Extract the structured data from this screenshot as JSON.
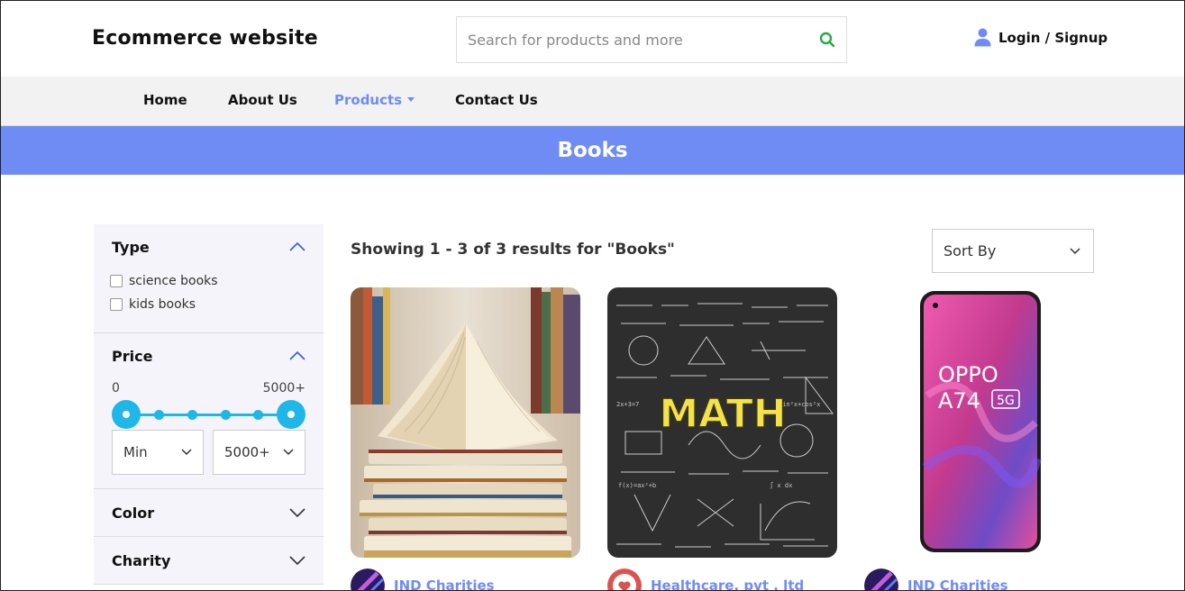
{
  "header": {
    "brand": "Ecommerce website",
    "search_placeholder": "Search for products and more",
    "login_label": "Login / Signup"
  },
  "nav": {
    "items": [
      "Home",
      "About Us",
      "Products",
      "Contact Us"
    ],
    "active": "Products"
  },
  "banner": {
    "title": "Books"
  },
  "filters": {
    "type": {
      "title": "Type",
      "options": [
        "science books",
        "kids books"
      ]
    },
    "price": {
      "title": "Price",
      "min_label": "0",
      "max_label": "5000+",
      "min_select": "Min",
      "max_select": "5000+"
    },
    "color": {
      "title": "Color"
    },
    "charity": {
      "title": "Charity"
    }
  },
  "results": {
    "summary": "Showing 1 - 3 of 3 results for \"Books\"",
    "sort_label": "Sort By"
  },
  "products": [
    {
      "image": "stack-of-open-books",
      "seller": "IND Charities"
    },
    {
      "image": "math-chalkboard",
      "seller": "Healthcare. pvt . ltd"
    },
    {
      "image": "oppo-a74-phone",
      "seller": "IND Charities",
      "image_text": [
        "OPPO",
        "A74",
        "5G"
      ]
    }
  ],
  "math_image_text": "MATH",
  "colors": {
    "accent": "#6f8cf5",
    "slider": "#1fb6e8",
    "search_icon": "#2aa84a",
    "nav_bg": "#f2f2f2",
    "sidebar_bg": "#f4f4fa"
  }
}
